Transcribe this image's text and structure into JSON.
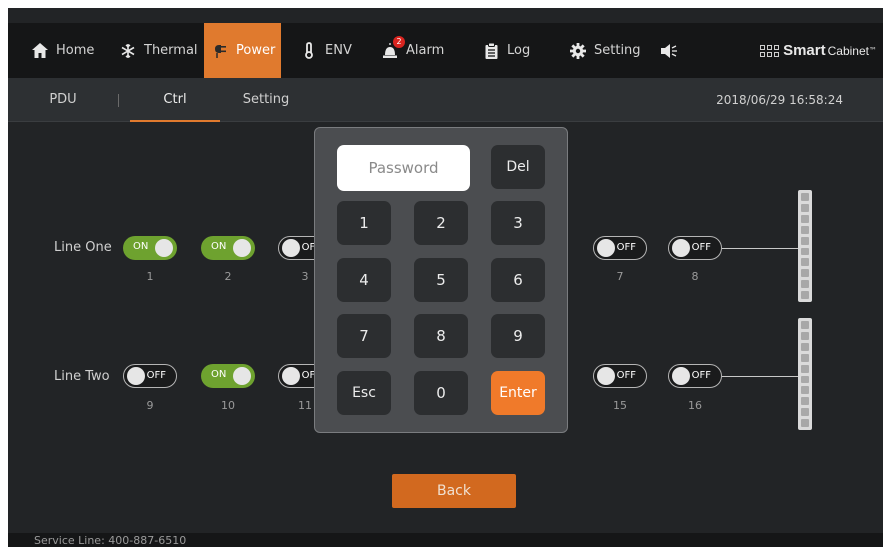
{
  "nav": {
    "items": [
      {
        "label": "Home",
        "icon": "home-icon"
      },
      {
        "label": "Thermal",
        "icon": "snowflake-icon"
      },
      {
        "label": "Power",
        "icon": "power-plug-icon"
      },
      {
        "label": "ENV",
        "icon": "thermometer-icon"
      },
      {
        "label": "Alarm",
        "icon": "alarm-light-icon",
        "badge": "2"
      },
      {
        "label": "Log",
        "icon": "clipboard-icon"
      },
      {
        "label": "Setting",
        "icon": "gear-icon"
      },
      {
        "label": "",
        "icon": "speaker-icon"
      }
    ],
    "active": "Power",
    "accent_color": "#e07a2e"
  },
  "brand": {
    "bold": "Smart",
    "light": "Cabinet",
    "mark": "™"
  },
  "subtabs": {
    "items": [
      {
        "label": "PDU"
      },
      {
        "label": "Ctrl"
      },
      {
        "label": "Setting"
      }
    ],
    "active": "Ctrl",
    "datetime": "2018/06/29 16:58:24"
  },
  "lines": [
    {
      "label": "Line One",
      "switches": [
        {
          "num": "1",
          "state": "ON"
        },
        {
          "num": "2",
          "state": "ON"
        },
        {
          "num": "3",
          "state": "OFF"
        },
        {
          "num": "7",
          "state": "OFF"
        },
        {
          "num": "8",
          "state": "OFF"
        }
      ]
    },
    {
      "label": "Line Two",
      "switches": [
        {
          "num": "9",
          "state": "OFF"
        },
        {
          "num": "10",
          "state": "ON"
        },
        {
          "num": "11",
          "state": "OFF"
        },
        {
          "num": "15",
          "state": "OFF"
        },
        {
          "num": "16",
          "state": "OFF"
        }
      ]
    }
  ],
  "colors": {
    "on": "#6ea22f",
    "off": "#1a1b1c",
    "enter": "#f07a2a",
    "back": "#d2691f"
  },
  "keypad": {
    "password_placeholder": "Password",
    "del": "Del",
    "keys": [
      "1",
      "2",
      "3",
      "4",
      "5",
      "6",
      "7",
      "8",
      "9",
      "Esc",
      "0",
      "Enter"
    ]
  },
  "back_label": "Back",
  "footer": "Service Line: 400-887-6510"
}
